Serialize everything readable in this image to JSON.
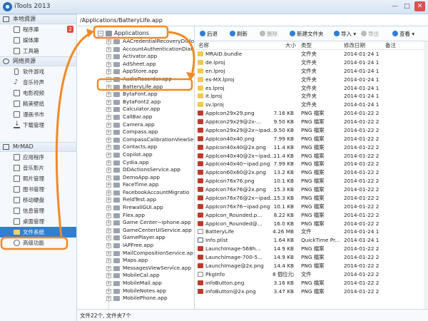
{
  "app": {
    "title": "iTools 2013",
    "colors": {
      "accent": "#2f7fd3",
      "annotation": "#f08a24"
    }
  },
  "window_controls": {
    "minimize": "—",
    "maximize": "□",
    "close": "✕"
  },
  "sidebar": {
    "section_local": "本地資源",
    "local_items": [
      {
        "label": "程序庫",
        "badge": "2"
      },
      {
        "label": "媒体庫"
      },
      {
        "label": "工具箱"
      }
    ],
    "section_network": "网络资源",
    "network_items": [
      {
        "label": "软件游戏"
      },
      {
        "label": "音乐铃声"
      },
      {
        "label": "电影视频"
      },
      {
        "label": "精美壁纸"
      },
      {
        "label": "漫画书市"
      },
      {
        "label": "下载管理"
      }
    ],
    "section_device": "MrMAD",
    "device_items": [
      {
        "label": "应用程序"
      },
      {
        "label": "音乐影片"
      },
      {
        "label": "照片管理"
      },
      {
        "label": "图书管理"
      },
      {
        "label": "移动硬盘"
      },
      {
        "label": "信息管理"
      },
      {
        "label": "桌面管理"
      },
      {
        "label": "文件系统"
      },
      {
        "label": "高级功能"
      }
    ]
  },
  "path": "/Applications/BatteryLife.app",
  "tree": {
    "root": "Applications",
    "items": [
      "AACredentialRecoveryDialo",
      "AccountAuthenticationDial",
      "Activator.app",
      "AdSheet.app",
      "AppStore.app",
      "AudioRecorder.app",
      "BatteryLife.app",
      "BytaFont.app",
      "BytaFont2.app",
      "Calculator.app",
      "CallBar.app",
      "Camera.app",
      "Compass.app",
      "CompassCalibrationViewSe",
      "Contacts.app",
      "Copilot.app",
      "Cydia.app",
      "DDActionsService.app",
      "DemoApp.app",
      "FaceTime.app",
      "FacebookAccountMigratio",
      "FieldTest.app",
      "FirewallGUI.app",
      "Flex.app",
      "Game Center~iphone.app",
      "GameCenterUIService.app",
      "GamePlayer.app",
      "IAPFree.app",
      "MailCompositionService.ap",
      "Maps.app",
      "MessagesViewService.app",
      "MobileCal.app",
      "MobileMail.app",
      "MobileNotes.app",
      "MobilePhone.app"
    ]
  },
  "toolbar": {
    "back": "后退",
    "refresh": "刷新",
    "delete": "删除",
    "new_folder": "新建文件夹",
    "import": "导入",
    "export": "导出",
    "view": "查看"
  },
  "table": {
    "headers": {
      "name": "名称",
      "size": "大小",
      "type": "类型",
      "date": "修改日期",
      "note": "备注"
    },
    "rows": [
      {
        "name": "MRAID.bundle",
        "size": "",
        "type": "文件夹",
        "date": "2014-01-24 1",
        "icon": "folder"
      },
      {
        "name": "de.lproj",
        "size": "",
        "type": "文件夹",
        "date": "2014-01-24 1",
        "icon": "folder"
      },
      {
        "name": "en.lproj",
        "size": "",
        "type": "文件夹",
        "date": "2014-01-24 1",
        "icon": "folder"
      },
      {
        "name": "es-MX.lproj",
        "size": "",
        "type": "文件夹",
        "date": "2014-01-24 1",
        "icon": "folder"
      },
      {
        "name": "es.lproj",
        "size": "",
        "type": "文件夹",
        "date": "2014-01-24 1",
        "icon": "folder"
      },
      {
        "name": "it.lproj",
        "size": "",
        "type": "文件夹",
        "date": "2014-01-24 1",
        "icon": "folder"
      },
      {
        "name": "sv.lproj",
        "size": "",
        "type": "文件夹",
        "date": "2014-01-24 1",
        "icon": "folder"
      },
      {
        "name": "AppIcon29x29.png",
        "size": "7.16 KB",
        "type": "PNG 檔案",
        "date": "2014-01-22 2",
        "icon": "png"
      },
      {
        "name": "AppIcon29x29@2x-...",
        "size": "9.50 KB",
        "type": "PNG 檔案",
        "date": "2014-01-22 2",
        "icon": "png"
      },
      {
        "name": "AppIcon29x29@2x~ipad...",
        "size": "9.50 KB",
        "type": "PNG 檔案",
        "date": "2014-01-22 2",
        "icon": "png"
      },
      {
        "name": "AppIcon40x40.png",
        "size": "7.99 KB",
        "type": "PNG 檔案",
        "date": "2014-01-22 2",
        "icon": "png"
      },
      {
        "name": "AppIcon40x40@2x.png",
        "size": "11.4 KB",
        "type": "PNG 檔案",
        "date": "2014-01-22 2",
        "icon": "png"
      },
      {
        "name": "AppIcon40x40@2x~ipad...",
        "size": "11.4 KB",
        "type": "PNG 檔案",
        "date": "2014-01-22 2",
        "icon": "png"
      },
      {
        "name": "AppIcon40x40~ipad.png",
        "size": "7.99 KB",
        "type": "PNG 檔案",
        "date": "2014-01-22 2",
        "icon": "png"
      },
      {
        "name": "AppIcon60x60@2x.png",
        "size": "13.2 KB",
        "type": "PNG 檔案",
        "date": "2014-01-22 2",
        "icon": "png"
      },
      {
        "name": "AppIcon76x76.png",
        "size": "10.1 KB",
        "type": "PNG 檔案",
        "date": "2014-01-22 2",
        "icon": "png"
      },
      {
        "name": "AppIcon76x76@2x.png",
        "size": "15.3 KB",
        "type": "PNG 檔案",
        "date": "2014-01-22 2",
        "icon": "png"
      },
      {
        "name": "AppIcon76x76@2x~ipad...",
        "size": "15.3 KB",
        "type": "PNG 檔案",
        "date": "2014-01-22 2",
        "icon": "png"
      },
      {
        "name": "AppIcon76x76~ipad.png",
        "size": "10.1 KB",
        "type": "PNG 檔案",
        "date": "2014-01-22 2",
        "icon": "png"
      },
      {
        "name": "AppIcon_Rounded.p...",
        "size": "8.22 KB",
        "type": "PNG 檔案",
        "date": "2014-01-22 2",
        "icon": "png"
      },
      {
        "name": "AppIcon_Rounded@...",
        "size": "16.0 KB",
        "type": "PNG 檔案",
        "date": "2014-01-22 2",
        "icon": "png"
      },
      {
        "name": "BatteryLife",
        "size": "4.26 MB",
        "type": "文件",
        "date": "2014-01-24 1",
        "icon": "file"
      },
      {
        "name": "Info.plist",
        "size": "1.64 KB",
        "type": "QuickTime Pr...",
        "date": "2014-01-24 1",
        "icon": "plist"
      },
      {
        "name": "LaunchImage-568h...",
        "size": "14.9 KB",
        "type": "PNG 檔案",
        "date": "2014-01-22 2",
        "icon": "png"
      },
      {
        "name": "LaunchImage-700-5...",
        "size": "14.9 KB",
        "type": "PNG 檔案",
        "date": "2014-01-22 2",
        "icon": "png"
      },
      {
        "name": "LaunchImage@2x.png",
        "size": "14.4 KB",
        "type": "PNG 檔案",
        "date": "2014-01-22 2",
        "icon": "png"
      },
      {
        "name": "PkgInfo",
        "size": "8 個位元組",
        "type": "文件",
        "date": "2014-01-22 2",
        "icon": "file"
      },
      {
        "name": "infoButton.png",
        "size": "3.16 KB",
        "type": "PNG 檔案",
        "date": "2014-01-22 2",
        "icon": "png"
      },
      {
        "name": "infoButton@2x.png",
        "size": "3.47 KB",
        "type": "PNG 檔案",
        "date": "2014-01-22 2",
        "icon": "png"
      }
    ]
  },
  "status": "文件22个, 文件夹7个"
}
